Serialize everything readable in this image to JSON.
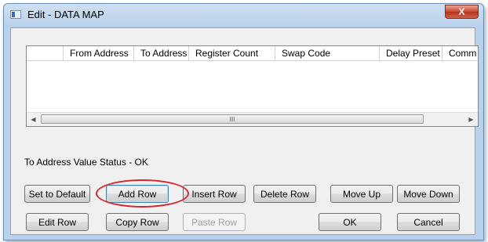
{
  "window": {
    "title": "Edit - DATA MAP",
    "close_label": "X"
  },
  "grid": {
    "columns": [
      "",
      "From Address",
      "To Address",
      "Register Count",
      "Swap Code",
      "Delay Preset",
      "Comm"
    ],
    "rows": []
  },
  "scrollbar": {
    "left_arrow": "◀",
    "right_arrow": "▶",
    "thumb_grip": "III"
  },
  "status": {
    "text": "To Address Value Status - OK"
  },
  "buttons": {
    "set_to_default": "Set to Default",
    "add_row": "Add Row",
    "insert_row": "Insert Row",
    "delete_row": "Delete Row",
    "move_up": "Move Up",
    "move_down": "Move Down",
    "edit_row": "Edit Row",
    "copy_row": "Copy Row",
    "paste_row": "Paste Row",
    "ok": "OK",
    "cancel": "Cancel"
  }
}
